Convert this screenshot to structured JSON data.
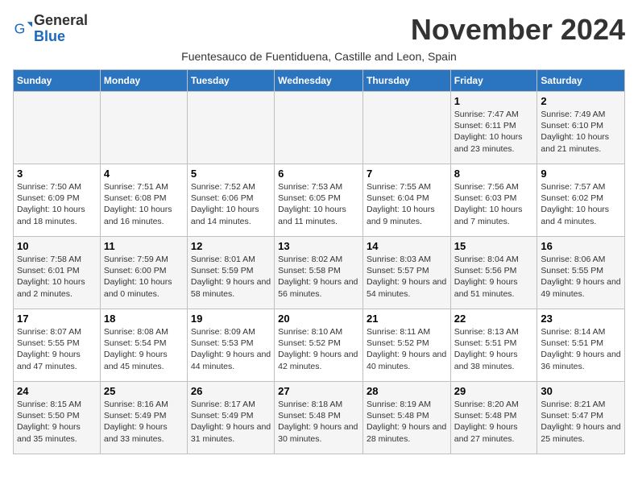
{
  "header": {
    "logo_general": "General",
    "logo_blue": "Blue",
    "month_year": "November 2024",
    "subtitle": "Fuentesauco de Fuentiduena, Castille and Leon, Spain"
  },
  "weekdays": [
    "Sunday",
    "Monday",
    "Tuesday",
    "Wednesday",
    "Thursday",
    "Friday",
    "Saturday"
  ],
  "weeks": [
    [
      {
        "day": "",
        "info": ""
      },
      {
        "day": "",
        "info": ""
      },
      {
        "day": "",
        "info": ""
      },
      {
        "day": "",
        "info": ""
      },
      {
        "day": "",
        "info": ""
      },
      {
        "day": "1",
        "info": "Sunrise: 7:47 AM\nSunset: 6:11 PM\nDaylight: 10 hours and 23 minutes."
      },
      {
        "day": "2",
        "info": "Sunrise: 7:49 AM\nSunset: 6:10 PM\nDaylight: 10 hours and 21 minutes."
      }
    ],
    [
      {
        "day": "3",
        "info": "Sunrise: 7:50 AM\nSunset: 6:09 PM\nDaylight: 10 hours and 18 minutes."
      },
      {
        "day": "4",
        "info": "Sunrise: 7:51 AM\nSunset: 6:08 PM\nDaylight: 10 hours and 16 minutes."
      },
      {
        "day": "5",
        "info": "Sunrise: 7:52 AM\nSunset: 6:06 PM\nDaylight: 10 hours and 14 minutes."
      },
      {
        "day": "6",
        "info": "Sunrise: 7:53 AM\nSunset: 6:05 PM\nDaylight: 10 hours and 11 minutes."
      },
      {
        "day": "7",
        "info": "Sunrise: 7:55 AM\nSunset: 6:04 PM\nDaylight: 10 hours and 9 minutes."
      },
      {
        "day": "8",
        "info": "Sunrise: 7:56 AM\nSunset: 6:03 PM\nDaylight: 10 hours and 7 minutes."
      },
      {
        "day": "9",
        "info": "Sunrise: 7:57 AM\nSunset: 6:02 PM\nDaylight: 10 hours and 4 minutes."
      }
    ],
    [
      {
        "day": "10",
        "info": "Sunrise: 7:58 AM\nSunset: 6:01 PM\nDaylight: 10 hours and 2 minutes."
      },
      {
        "day": "11",
        "info": "Sunrise: 7:59 AM\nSunset: 6:00 PM\nDaylight: 10 hours and 0 minutes."
      },
      {
        "day": "12",
        "info": "Sunrise: 8:01 AM\nSunset: 5:59 PM\nDaylight: 9 hours and 58 minutes."
      },
      {
        "day": "13",
        "info": "Sunrise: 8:02 AM\nSunset: 5:58 PM\nDaylight: 9 hours and 56 minutes."
      },
      {
        "day": "14",
        "info": "Sunrise: 8:03 AM\nSunset: 5:57 PM\nDaylight: 9 hours and 54 minutes."
      },
      {
        "day": "15",
        "info": "Sunrise: 8:04 AM\nSunset: 5:56 PM\nDaylight: 9 hours and 51 minutes."
      },
      {
        "day": "16",
        "info": "Sunrise: 8:06 AM\nSunset: 5:55 PM\nDaylight: 9 hours and 49 minutes."
      }
    ],
    [
      {
        "day": "17",
        "info": "Sunrise: 8:07 AM\nSunset: 5:55 PM\nDaylight: 9 hours and 47 minutes."
      },
      {
        "day": "18",
        "info": "Sunrise: 8:08 AM\nSunset: 5:54 PM\nDaylight: 9 hours and 45 minutes."
      },
      {
        "day": "19",
        "info": "Sunrise: 8:09 AM\nSunset: 5:53 PM\nDaylight: 9 hours and 44 minutes."
      },
      {
        "day": "20",
        "info": "Sunrise: 8:10 AM\nSunset: 5:52 PM\nDaylight: 9 hours and 42 minutes."
      },
      {
        "day": "21",
        "info": "Sunrise: 8:11 AM\nSunset: 5:52 PM\nDaylight: 9 hours and 40 minutes."
      },
      {
        "day": "22",
        "info": "Sunrise: 8:13 AM\nSunset: 5:51 PM\nDaylight: 9 hours and 38 minutes."
      },
      {
        "day": "23",
        "info": "Sunrise: 8:14 AM\nSunset: 5:51 PM\nDaylight: 9 hours and 36 minutes."
      }
    ],
    [
      {
        "day": "24",
        "info": "Sunrise: 8:15 AM\nSunset: 5:50 PM\nDaylight: 9 hours and 35 minutes."
      },
      {
        "day": "25",
        "info": "Sunrise: 8:16 AM\nSunset: 5:49 PM\nDaylight: 9 hours and 33 minutes."
      },
      {
        "day": "26",
        "info": "Sunrise: 8:17 AM\nSunset: 5:49 PM\nDaylight: 9 hours and 31 minutes."
      },
      {
        "day": "27",
        "info": "Sunrise: 8:18 AM\nSunset: 5:48 PM\nDaylight: 9 hours and 30 minutes."
      },
      {
        "day": "28",
        "info": "Sunrise: 8:19 AM\nSunset: 5:48 PM\nDaylight: 9 hours and 28 minutes."
      },
      {
        "day": "29",
        "info": "Sunrise: 8:20 AM\nSunset: 5:48 PM\nDaylight: 9 hours and 27 minutes."
      },
      {
        "day": "30",
        "info": "Sunrise: 8:21 AM\nSunset: 5:47 PM\nDaylight: 9 hours and 25 minutes."
      }
    ]
  ]
}
